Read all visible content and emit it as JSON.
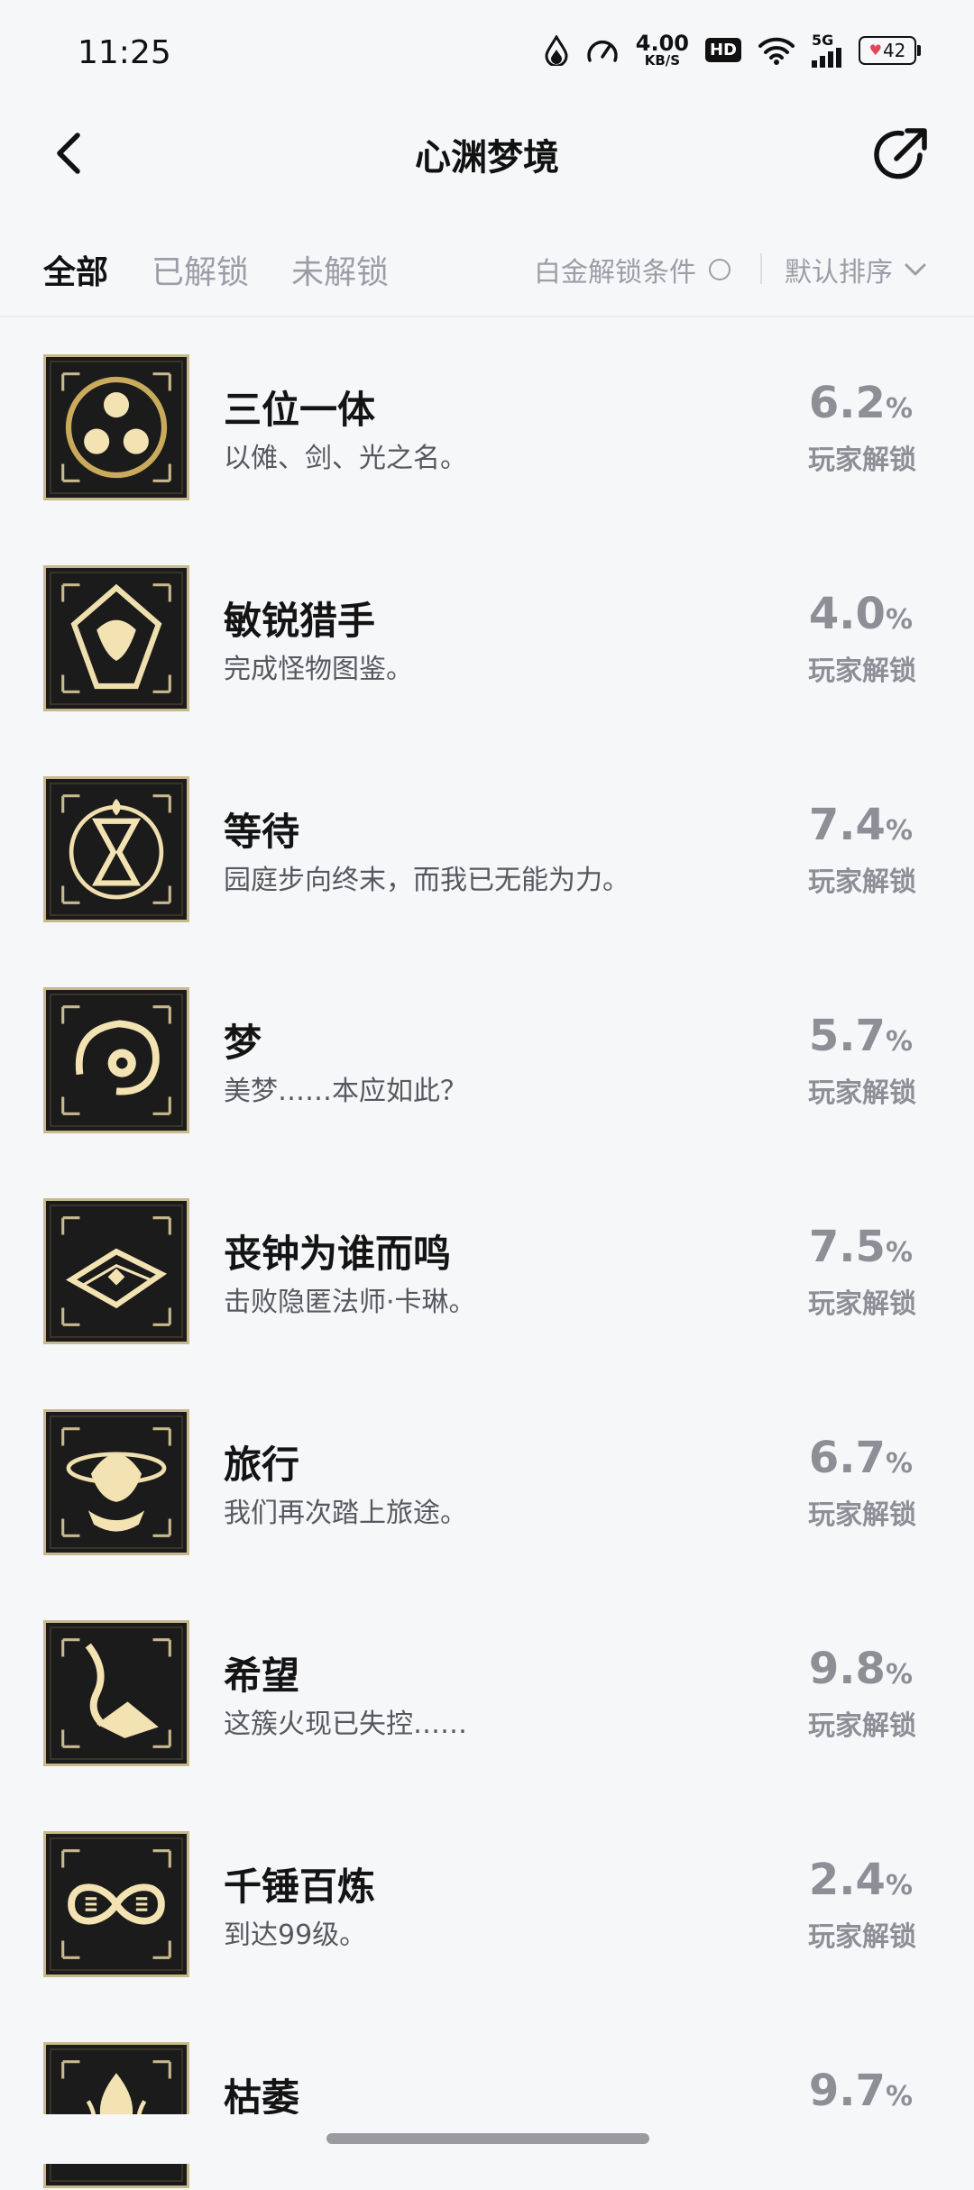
{
  "status_bar": {
    "time": "11:25",
    "net_speed_value": "4.00",
    "net_speed_unit": "KB/S",
    "hd": "HD",
    "network": "5G",
    "battery": "42"
  },
  "header": {
    "title": "心渊梦境"
  },
  "tabs": [
    {
      "label": "全部",
      "active": true
    },
    {
      "label": "已解锁",
      "active": false
    },
    {
      "label": "未解锁",
      "active": false
    }
  ],
  "filters": {
    "condition_label": "白金解锁条件",
    "sort_label": "默认排序"
  },
  "unlock_label": "玩家解锁",
  "achievements": [
    {
      "title": "三位一体",
      "desc": "以傩、剑、光之名。",
      "percent": "6.2",
      "icon": "trinity-emblem-icon"
    },
    {
      "title": "敏锐猎手",
      "desc": "完成怪物图鉴。",
      "percent": "4.0",
      "icon": "hunter-emblem-icon"
    },
    {
      "title": "等待",
      "desc": "园庭步向终末，而我已无能为力。",
      "percent": "7.4",
      "icon": "hourglass-lantern-icon"
    },
    {
      "title": "梦",
      "desc": "美梦……本应如此？",
      "percent": "5.7",
      "icon": "dream-creature-icon"
    },
    {
      "title": "丧钟为谁而鸣",
      "desc": "击败隐匿法师·卡琳。",
      "percent": "7.5",
      "icon": "spellbook-icon"
    },
    {
      "title": "旅行",
      "desc": "我们再次踏上旅途。",
      "percent": "6.7",
      "icon": "journey-mask-icon"
    },
    {
      "title": "希望",
      "desc": "这簇火现已失控……",
      "percent": "9.8",
      "icon": "flame-wing-icon"
    },
    {
      "title": "千锤百炼",
      "desc": "到达99级。",
      "percent": "2.4",
      "icon": "infinity-icon"
    },
    {
      "title": "枯萎",
      "desc": "",
      "percent": "9.7",
      "icon": "withered-flame-icon"
    }
  ]
}
